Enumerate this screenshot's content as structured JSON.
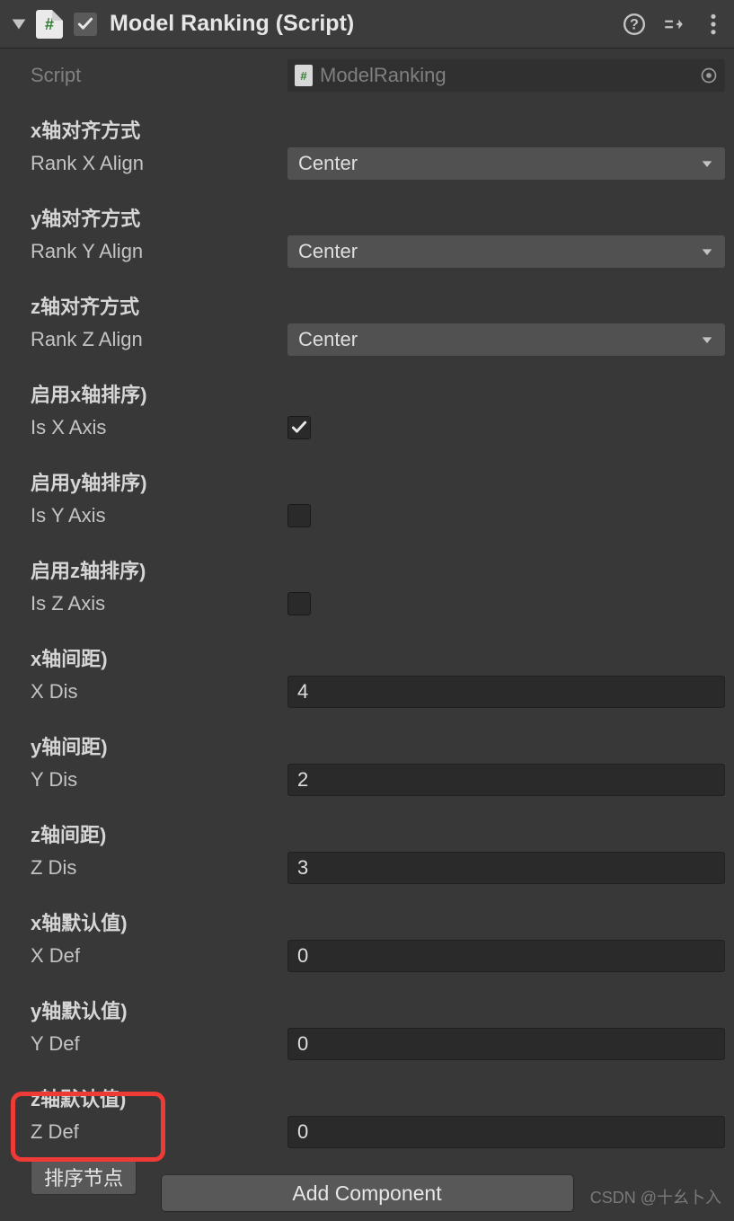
{
  "header": {
    "title": "Model Ranking (Script)",
    "enabledChecked": true
  },
  "fields": {
    "scriptLabel": "Script",
    "scriptValue": "ModelRanking",
    "xAlign": {
      "group": "x轴对齐方式",
      "label": "Rank X Align",
      "value": "Center"
    },
    "yAlign": {
      "group": "y轴对齐方式",
      "label": "Rank Y Align",
      "value": "Center"
    },
    "zAlign": {
      "group": "z轴对齐方式",
      "label": "Rank Z Align",
      "value": "Center"
    },
    "isX": {
      "group": "启用x轴排序)",
      "label": "Is X Axis",
      "checked": true
    },
    "isY": {
      "group": "启用y轴排序)",
      "label": "Is Y Axis",
      "checked": false
    },
    "isZ": {
      "group": "启用z轴排序)",
      "label": "Is Z Axis",
      "checked": false
    },
    "xDis": {
      "group": "x轴间距)",
      "label": "X Dis",
      "value": "4"
    },
    "yDis": {
      "group": "y轴间距)",
      "label": "Y Dis",
      "value": "2"
    },
    "zDis": {
      "group": "z轴间距)",
      "label": "Z Dis",
      "value": "3"
    },
    "xDef": {
      "group": "x轴默认值)",
      "label": "X Def",
      "value": "0"
    },
    "yDef": {
      "group": "y轴默认值)",
      "label": "Y Def",
      "value": "0"
    },
    "zDef": {
      "group": "z轴默认值)",
      "label": "Z Def",
      "value": "0"
    }
  },
  "buttons": {
    "sort": "排序节点",
    "addComponent": "Add Component"
  },
  "watermark": "CSDN @十幺卜入"
}
